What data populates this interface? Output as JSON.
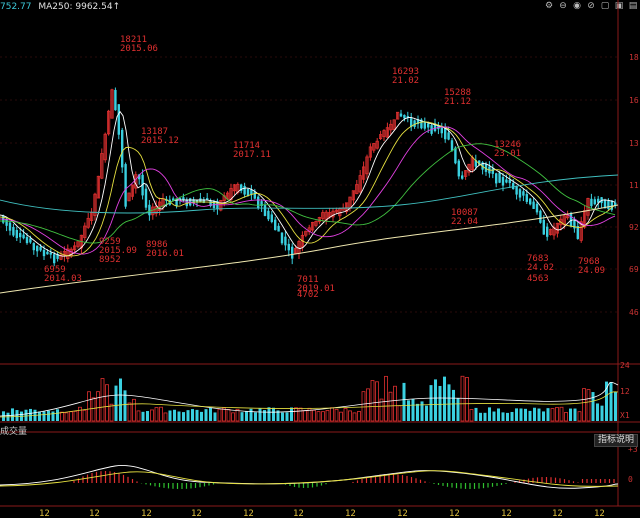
{
  "header": {
    "ma_value_1": "752.77",
    "ma250_label": "MA250: 9962.54↑",
    "icons": [
      "settings-icon",
      "minus-icon",
      "eye-icon",
      "link-icon",
      "layers-icon",
      "chart-icon",
      "window-icon"
    ]
  },
  "price_axis": {
    "ticks": [
      "18",
      "16",
      "13",
      "11",
      "92",
      "69",
      "46"
    ]
  },
  "annotations": [
    {
      "price": "18211",
      "date": "2015.06"
    },
    {
      "price": "13187",
      "date": "2015.12"
    },
    {
      "price": "11714",
      "date": "2017.11"
    },
    {
      "price": "16293",
      "date": "21.02"
    },
    {
      "price": "15288",
      "date": "21.12"
    },
    {
      "price": "13246",
      "date": "23.01"
    },
    {
      "price": "10087",
      "date": "22.04"
    },
    {
      "price": "9259",
      "date": "2015.09"
    },
    {
      "price": "8952",
      "date": ""
    },
    {
      "price": "8986",
      "date": "2016.01"
    },
    {
      "price": "6959",
      "date": "2014.03"
    },
    {
      "price": "7011",
      "date": "2019.01"
    },
    {
      "price": "4702",
      "date": ""
    },
    {
      "price": "7683",
      "date": "24.02"
    },
    {
      "price": "4563",
      "date": ""
    },
    {
      "price": "7968",
      "date": "24.09"
    }
  ],
  "volume": {
    "title": "成交量",
    "axis": [
      "24",
      "12",
      "X1"
    ]
  },
  "macd": {
    "button": "指标说明",
    "axis": [
      "+3",
      "0"
    ]
  },
  "time_axis": [
    "12",
    "12",
    "12",
    "12",
    "12",
    "12",
    "12",
    "12",
    "12",
    "12",
    "12",
    "12"
  ],
  "colors": {
    "up": "#e03030",
    "down": "#3ad0e0",
    "ma5": "#ffffff",
    "ma10": "#e6e040",
    "ma20": "#e040e0",
    "ma60": "#40c040",
    "ma120": "#40c0c0",
    "ma250": "#f0e8b0"
  }
}
